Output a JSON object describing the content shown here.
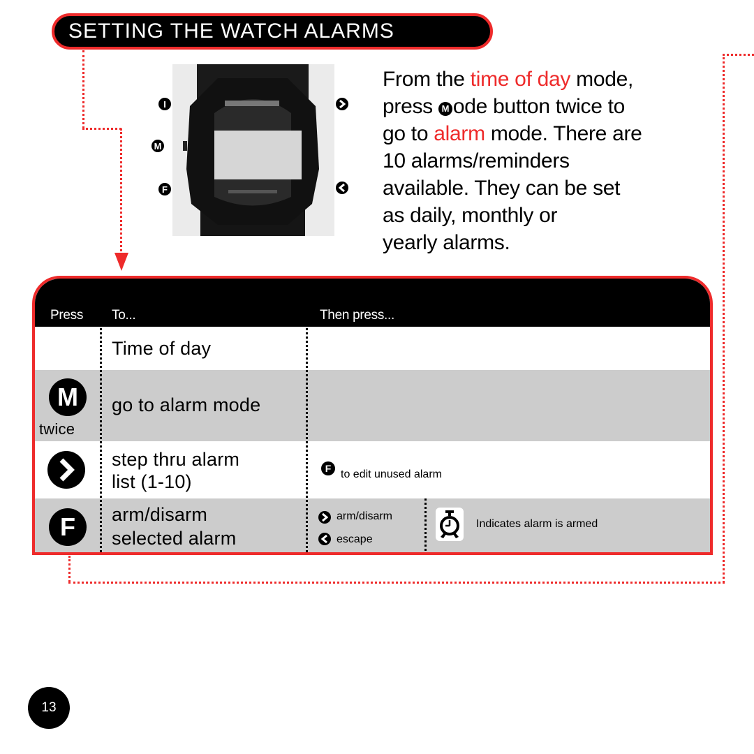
{
  "title": "SETTING THE WATCH ALARMS",
  "watch_buttons": {
    "top_left": "I",
    "mid_left": "M",
    "bottom_left": "F",
    "top_right": "next-arrow",
    "bottom_right": "back-arrow"
  },
  "intro": {
    "p1": "From the ",
    "p1_red": "time of day",
    "p2": " mode,",
    "p3": "press ",
    "p3_button": "M",
    "p4": "ode button twice to",
    "p5": "go to ",
    "p5_red": "alarm",
    "p6": " mode. There are",
    "p7": "10 alarms/reminders",
    "p8": "available. They can be set",
    "p9": "as daily, monthly or",
    "p10": "yearly alarms."
  },
  "table": {
    "headers": {
      "press": "Press",
      "to": "To...",
      "then": "Then press..."
    },
    "rows": [
      {
        "press_button": "",
        "press_note": "",
        "to": "Time of day"
      },
      {
        "press_button": "M",
        "press_note": "twice",
        "to": "go to alarm mode"
      },
      {
        "press_button": "next-arrow",
        "to_line1": "step thru alarm",
        "to_line2": "list (1-10)",
        "then_button": "F",
        "then_text": "to edit unused alarm"
      },
      {
        "press_button": "F",
        "to_line1": "arm/disarm",
        "to_line2": "selected alarm",
        "then_items": [
          {
            "button": "next-arrow",
            "text": "arm/disarm"
          },
          {
            "button": "back-arrow",
            "text": "escape"
          }
        ],
        "legend_icon": "alarm-clock-icon",
        "legend_text": "Indicates alarm is armed"
      }
    ]
  },
  "colors": {
    "accent": "#ee2b2b",
    "row_gray": "#cccccc",
    "header_bg": "#000000"
  },
  "page_number": "13"
}
